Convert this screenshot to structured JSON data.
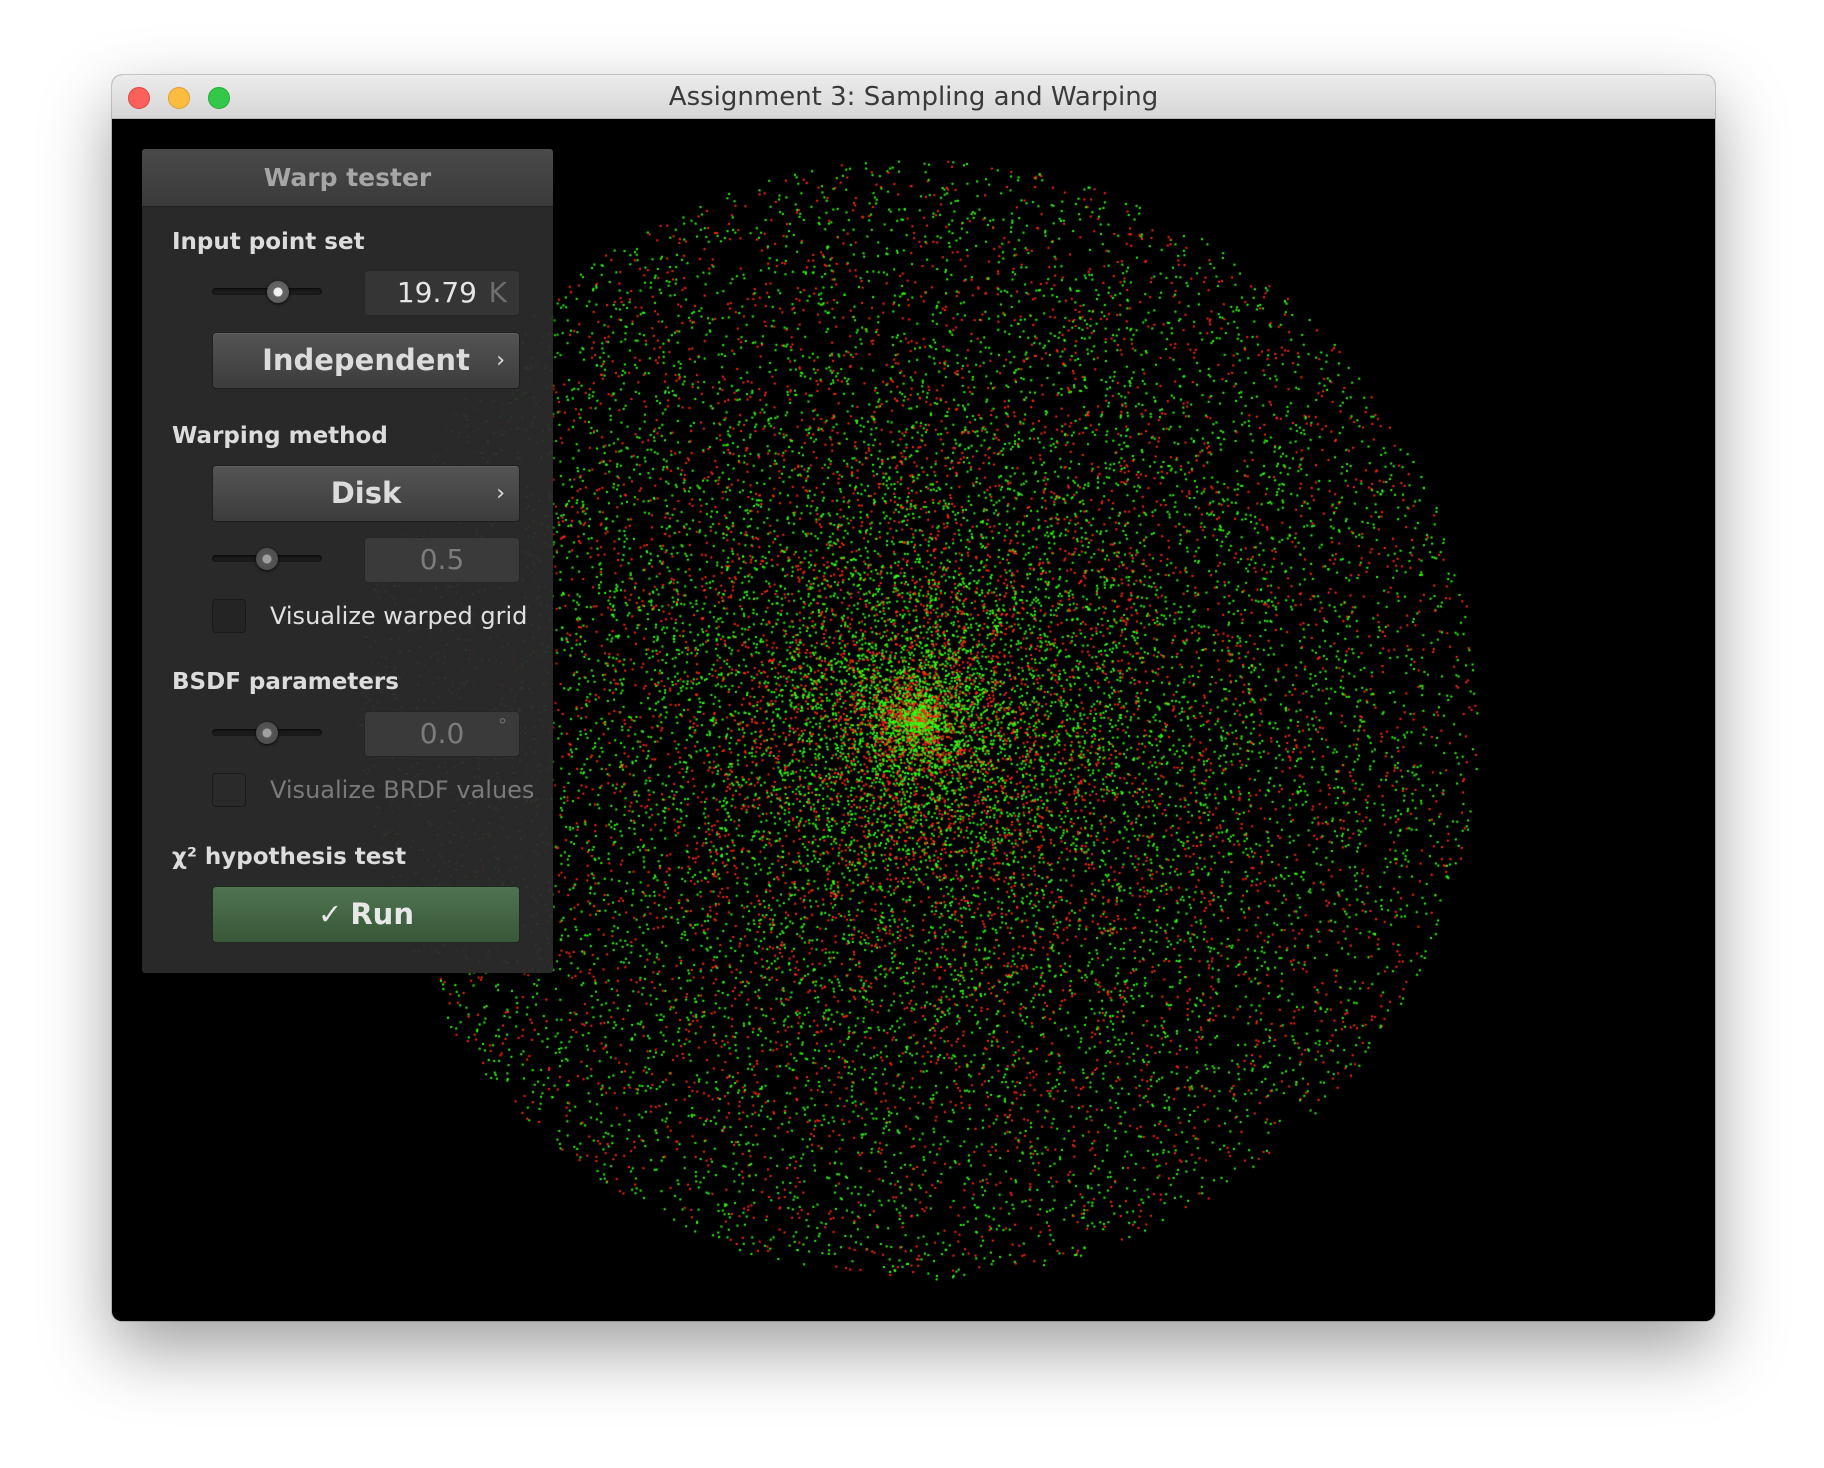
{
  "window": {
    "title": "Assignment 3: Sampling and Warping"
  },
  "panel": {
    "title": "Warp tester",
    "input_point_set": {
      "label": "Input point set",
      "slider_value": 0.6,
      "count_value": "19.79",
      "count_unit": "K",
      "sampler": "Independent",
      "chevron": "›"
    },
    "warping_method": {
      "label": "Warping method",
      "method": "Disk",
      "chevron": "›",
      "param_slider_value": 0.5,
      "param_value": "0.5",
      "grid_checkbox_label": "Visualize warped grid",
      "grid_checkbox_checked": false
    },
    "bsdf_parameters": {
      "label": "BSDF parameters",
      "slider_value": 0.5,
      "angle_value": "0.0",
      "angle_unit": "°",
      "brdf_checkbox_label": "Visualize BRDF values",
      "brdf_checkbox_checked": false
    },
    "hypothesis_test": {
      "label": "χ² hypothesis test",
      "run_icon": "checkmark-icon",
      "run_check_glyph": "✓",
      "run_label": "Run"
    }
  },
  "colors": {
    "point_green": "#33ff14",
    "point_red": "#ff2a14",
    "run_button": "#456a46"
  }
}
